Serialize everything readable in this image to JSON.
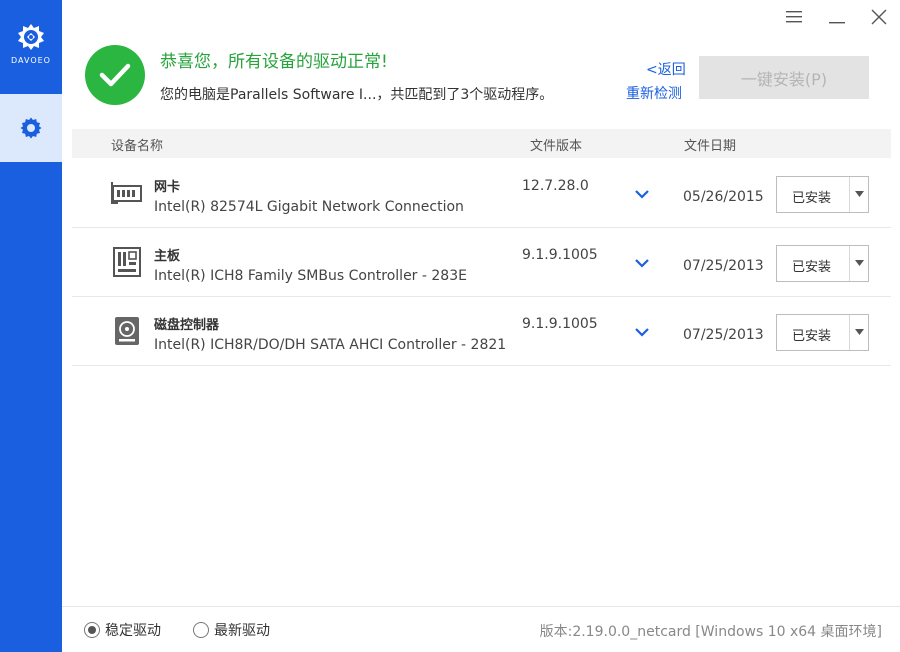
{
  "app": {
    "logo_text": "DAVOEO"
  },
  "window": {
    "menu_icon": "hamburger-icon",
    "minimize_icon": "minimize-icon",
    "close_icon": "close-icon"
  },
  "colors": {
    "accent": "#1a5fe0",
    "success": "#2ab640",
    "link": "#1a5fe0",
    "disabled_button": "#e3e3e3"
  },
  "header": {
    "title": "恭喜您，所有设备的驱动正常!",
    "subtitle": "您的电脑是Parallels Software I...，共匹配到了3个驱动程序。",
    "back_link": "<返回",
    "rescan_link": "重新检测",
    "install_all_button": "一键安装(P)"
  },
  "table": {
    "columns": {
      "name": "设备名称",
      "version": "文件版本",
      "date": "文件日期"
    },
    "rows": [
      {
        "icon": "network-card-icon",
        "category": "网卡",
        "name": "Intel(R) 82574L Gigabit Network Connection",
        "version": "12.7.28.0",
        "date": "05/26/2015",
        "status": "已安装"
      },
      {
        "icon": "motherboard-icon",
        "category": "主板",
        "name": "Intel(R) ICH8 Family SMBus Controller - 283E",
        "version": "9.1.9.1005",
        "date": "07/25/2013",
        "status": "已安装"
      },
      {
        "icon": "disk-controller-icon",
        "category": "磁盘控制器",
        "name": "Intel(R) ICH8R/DO/DH SATA AHCI Controller - 2821",
        "version": "9.1.9.1005",
        "date": "07/25/2013",
        "status": "已安装"
      }
    ]
  },
  "footer": {
    "radio_stable": "稳定驱动",
    "radio_latest": "最新驱动",
    "selected": "stable",
    "version_text": "版本:2.19.0.0_netcard [Windows 10 x64 桌面环境]"
  }
}
